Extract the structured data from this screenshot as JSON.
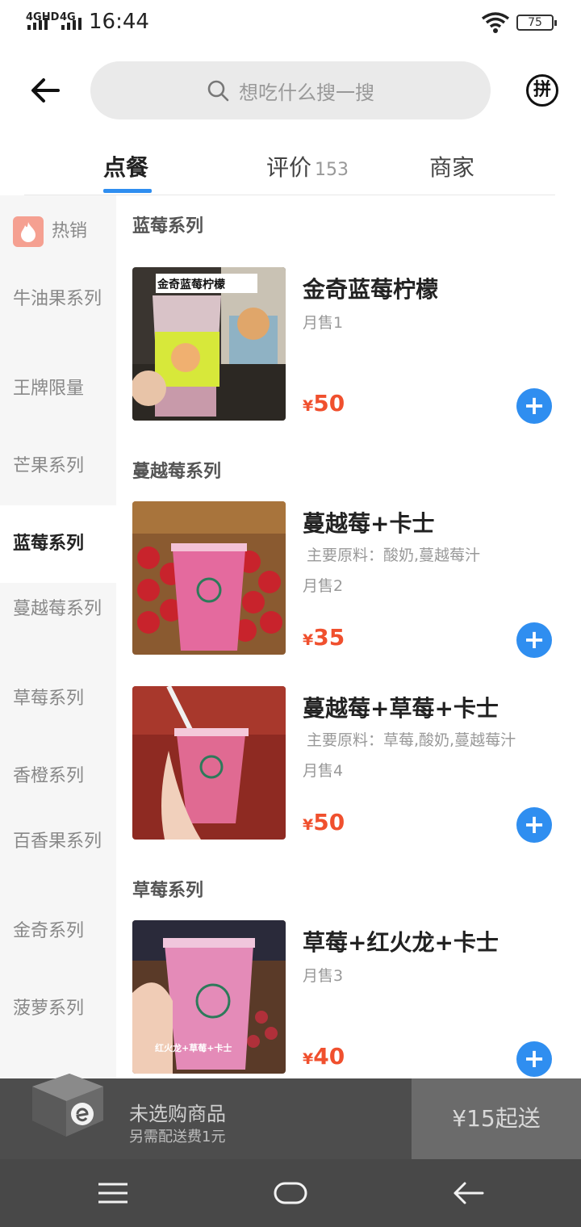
{
  "status_bar": {
    "network_left": "4GHD",
    "network_right": "4G",
    "time": "16:44",
    "battery": "75"
  },
  "header": {
    "search_placeholder": "想吃什么搜一搜",
    "pin_label": "拼"
  },
  "tabs": [
    {
      "label": "点餐",
      "active": true
    },
    {
      "label": "评价",
      "count": "153"
    },
    {
      "label": "商家"
    }
  ],
  "sidebar": {
    "items": [
      {
        "label": "热销",
        "icon": "flame-icon"
      },
      {
        "label": "牛油果系列"
      },
      {
        "label": "王牌限量"
      },
      {
        "label": "芒果系列"
      },
      {
        "label": "蓝莓系列",
        "active": true
      },
      {
        "label": "蔓越莓系列"
      },
      {
        "label": "草莓系列"
      },
      {
        "label": "香橙系列"
      },
      {
        "label": "百香果系列"
      },
      {
        "label": "金奇系列"
      },
      {
        "label": "菠萝系列"
      }
    ]
  },
  "sections": [
    {
      "title": "蓝莓系列",
      "items": [
        {
          "name": "金奇蓝莓柠檬",
          "sold": "月售1",
          "currency": "¥",
          "price": "50",
          "image_label": "金奇蓝莓柠檬"
        }
      ]
    },
    {
      "title": "蔓越莓系列",
      "items": [
        {
          "name": "蔓越莓+卡士",
          "ingredients": "主要原料：酸奶,蔓越莓汁",
          "sold": "月售2",
          "currency": "¥",
          "price": "35"
        },
        {
          "name": "蔓越莓+草莓+卡士",
          "ingredients": "主要原料：草莓,酸奶,蔓越莓汁",
          "sold": "月售4",
          "currency": "¥",
          "price": "50"
        }
      ]
    },
    {
      "title": "草莓系列",
      "items": [
        {
          "name": "草莓+红火龙+卡士",
          "sold": "月售3",
          "currency": "¥",
          "price": "40",
          "image_label": "红火龙+草莓+卡士"
        }
      ]
    }
  ],
  "cart": {
    "title": "未选购商品",
    "delivery_note": "另需配送费1元",
    "min_order": "¥15起送"
  },
  "colors": {
    "accent": "#2f8ef0",
    "price": "#f0502e",
    "cart_bar": "#4d4d4d"
  }
}
